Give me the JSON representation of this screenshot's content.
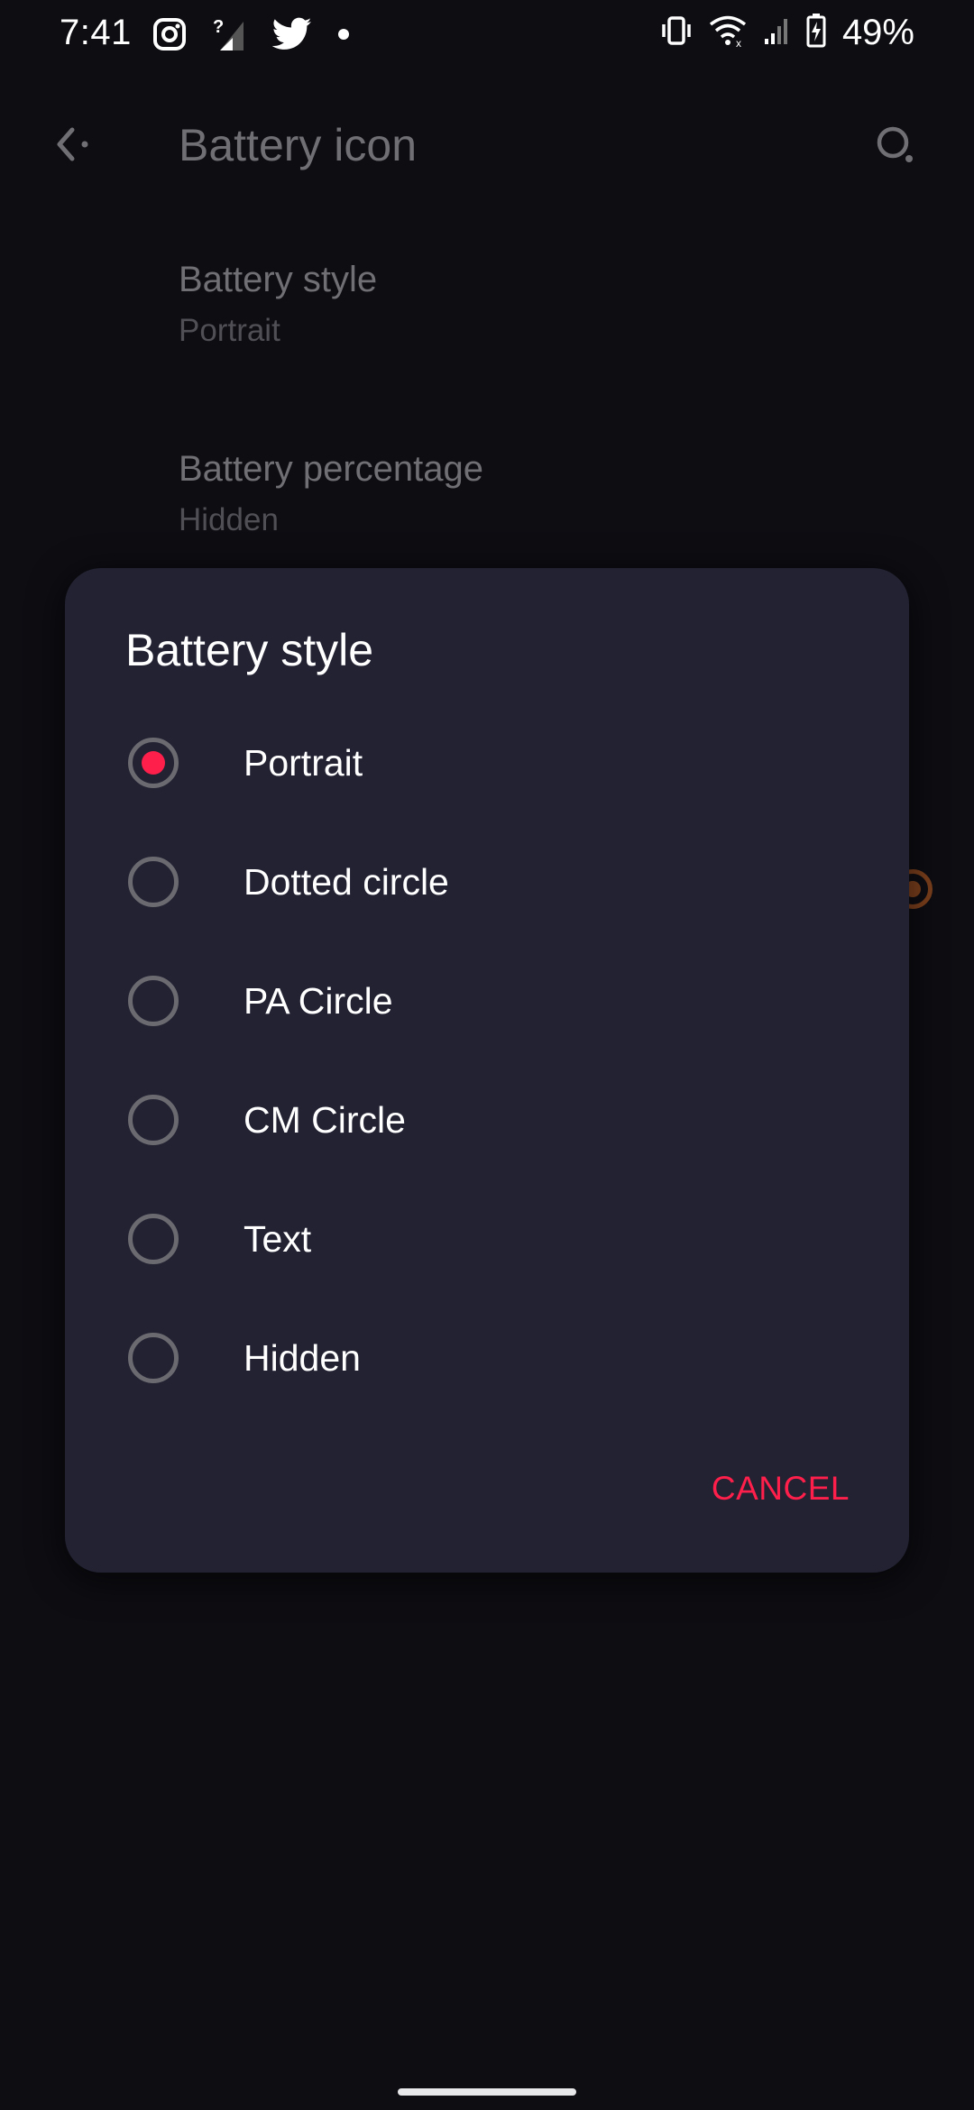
{
  "status_bar": {
    "time": "7:41",
    "battery_percent": "49%",
    "left_icons": [
      "instagram-icon",
      "signal-unknown-icon",
      "twitter-icon",
      "dot-icon"
    ],
    "right_icons": [
      "vibrate-icon",
      "wifi-icon",
      "cell-signal-icon",
      "battery-charging-icon"
    ]
  },
  "app_bar": {
    "title": "Battery icon",
    "back_icon": "back-arrow-icon",
    "search_icon": "search-icon"
  },
  "settings": [
    {
      "title": "Battery style",
      "summary": "Portrait"
    },
    {
      "title": "Battery percentage",
      "summary": "Hidden"
    }
  ],
  "dialog": {
    "title": "Battery style",
    "options": [
      {
        "label": "Portrait",
        "checked": true
      },
      {
        "label": "Dotted circle",
        "checked": false
      },
      {
        "label": "PA Circle",
        "checked": false
      },
      {
        "label": "CM Circle",
        "checked": false
      },
      {
        "label": "Text",
        "checked": false
      },
      {
        "label": "Hidden",
        "checked": false
      }
    ],
    "cancel_label": "CANCEL",
    "accent_color": "#ff1f4b"
  }
}
